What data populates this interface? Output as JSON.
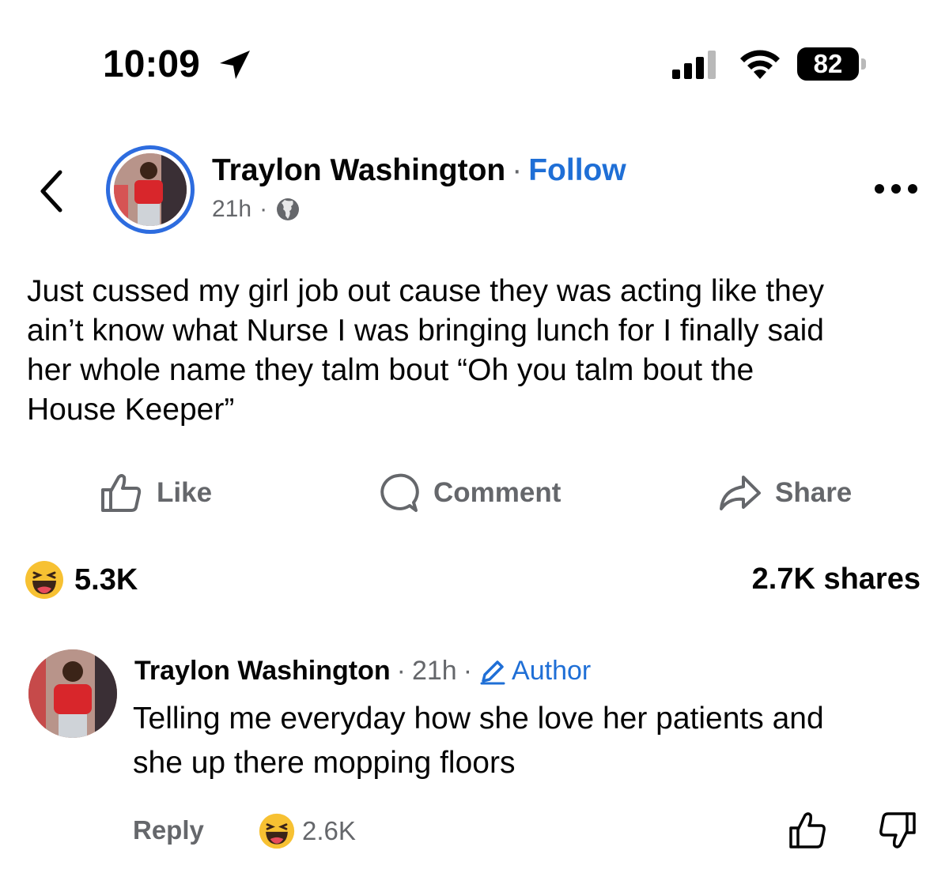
{
  "status_bar": {
    "time": "10:09",
    "battery": "82"
  },
  "post": {
    "author": "Traylon Washington",
    "separator": "·",
    "follow_label": "Follow",
    "time": "21h",
    "meta_separator": "·",
    "text": "Just cussed my girl job out cause they was acting like they\nain’t know what Nurse I was bringing lunch for I finally said\nher whole name they talm bout “Oh you talm bout the\nHouse Keeper”"
  },
  "actions": {
    "like": "Like",
    "comment": "Comment",
    "share": "Share"
  },
  "stats": {
    "reactions": "5.3K",
    "shares": "2.7K shares"
  },
  "comment": {
    "author": "Traylon Washington",
    "sep1": "·",
    "time": "21h",
    "sep2": "·",
    "badge": "Author",
    "text": "Telling me everyday how she love her patients and\nshe up there mopping floors",
    "reply": "Reply",
    "reactions": "2.6K"
  },
  "colors": {
    "accent": "#1f6fd6",
    "ring": "#2d6cdf",
    "muted": "#65676b",
    "emoji": "#f7c132"
  },
  "icons": [
    "location-arrow-icon",
    "signal-icon",
    "wifi-icon",
    "battery-icon",
    "back-chevron-icon",
    "globe-icon",
    "more-icon",
    "like-icon",
    "comment-icon",
    "share-icon",
    "haha-emoji-icon",
    "pencil-icon",
    "thumbs-up-icon",
    "thumbs-down-icon"
  ]
}
